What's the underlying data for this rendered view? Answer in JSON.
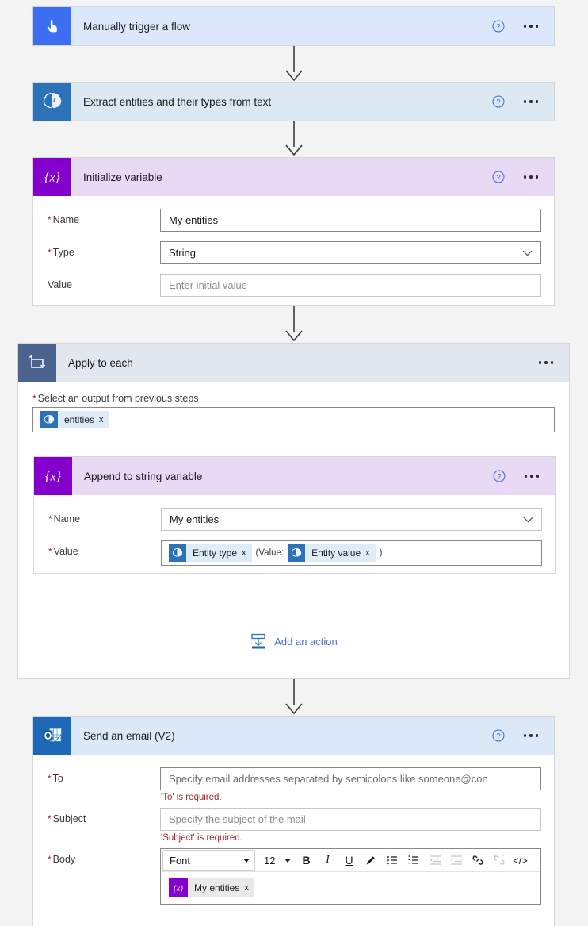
{
  "flow": {
    "trigger": {
      "title": "Manually trigger a flow",
      "icon": "hand-pointer-icon",
      "help": "help-icon",
      "menu": "more-options-icon"
    },
    "extract": {
      "title": "Extract entities and their types from text",
      "icon": "ai-builder-brain-icon"
    },
    "initialize": {
      "title": "Initialize variable",
      "icon": "variable-braces-icon",
      "fields": [
        {
          "label": "Name",
          "required": true,
          "value": "My entities",
          "placeholder": "",
          "type": "text"
        },
        {
          "label": "Type",
          "required": true,
          "value": "String",
          "placeholder": "",
          "type": "dropdown"
        },
        {
          "label": "Value",
          "required": false,
          "value": "",
          "placeholder": "Enter initial value",
          "type": "text"
        }
      ]
    },
    "loop": {
      "title": "Apply to each",
      "icon": "loop-icon",
      "input_label": "Select an output from previous steps",
      "input_required": true,
      "input_token": {
        "label": "entities",
        "icon": "ai-builder-brain-icon",
        "close": "x"
      },
      "add_action_label": "Add an action",
      "add_action_icon": "add-action-icon",
      "append": {
        "title": "Append to string variable",
        "icon": "variable-braces-icon",
        "name_label": "Name",
        "name_value": "My entities",
        "value_label": "Value",
        "value_tokens": [
          {
            "kind": "token",
            "label": "Entity type",
            "icon": "ai-builder-brain-icon",
            "close": "x"
          },
          {
            "kind": "text",
            "label": "(Value:"
          },
          {
            "kind": "token",
            "label": "Entity value",
            "icon": "ai-builder-brain-icon",
            "close": "x"
          },
          {
            "kind": "text",
            "label": ")"
          }
        ]
      }
    },
    "email": {
      "title": "Send an email (V2)",
      "icon": "outlook-icon",
      "to": {
        "label": "To",
        "required": true,
        "value": "",
        "placeholder": "Specify email addresses separated by semicolons like someone@con",
        "error": "'To' is required."
      },
      "subject": {
        "label": "Subject",
        "required": true,
        "value": "",
        "placeholder": "Specify the subject of the mail",
        "error": "'Subject' is required."
      },
      "body": {
        "label": "Body",
        "required": true,
        "toolbar": {
          "font_label": "Font",
          "size_label": "12",
          "buttons": [
            {
              "name": "bold-icon",
              "glyph": "B",
              "enabled": true
            },
            {
              "name": "italic-icon",
              "glyph": "I",
              "enabled": true
            },
            {
              "name": "underline-icon",
              "glyph": "U",
              "enabled": true
            },
            {
              "name": "text-color-pen-icon",
              "glyph": "",
              "enabled": true
            },
            {
              "name": "bulleted-list-icon",
              "glyph": "",
              "enabled": true
            },
            {
              "name": "numbered-list-icon",
              "glyph": "",
              "enabled": true
            },
            {
              "name": "decrease-indent-icon",
              "glyph": "",
              "enabled": false
            },
            {
              "name": "increase-indent-icon",
              "glyph": "",
              "enabled": false
            },
            {
              "name": "insert-link-icon",
              "glyph": "",
              "enabled": true
            },
            {
              "name": "remove-link-icon",
              "glyph": "",
              "enabled": false
            },
            {
              "name": "code-view-icon",
              "glyph": "</>",
              "enabled": true
            }
          ]
        },
        "content_token": {
          "label": "My entities",
          "icon": "variable-braces-icon",
          "close": "x"
        }
      }
    }
  },
  "colors": {
    "trigger_icon": "#3b6ef0",
    "ai_icon": "#2c72b8",
    "variable_icon": "#8400cc",
    "loop_icon": "#4a648f",
    "outlook_icon": "#1e68b8",
    "link": "#4a6fd4",
    "error": "#a4262c",
    "canvas": "#f3f3f3"
  }
}
